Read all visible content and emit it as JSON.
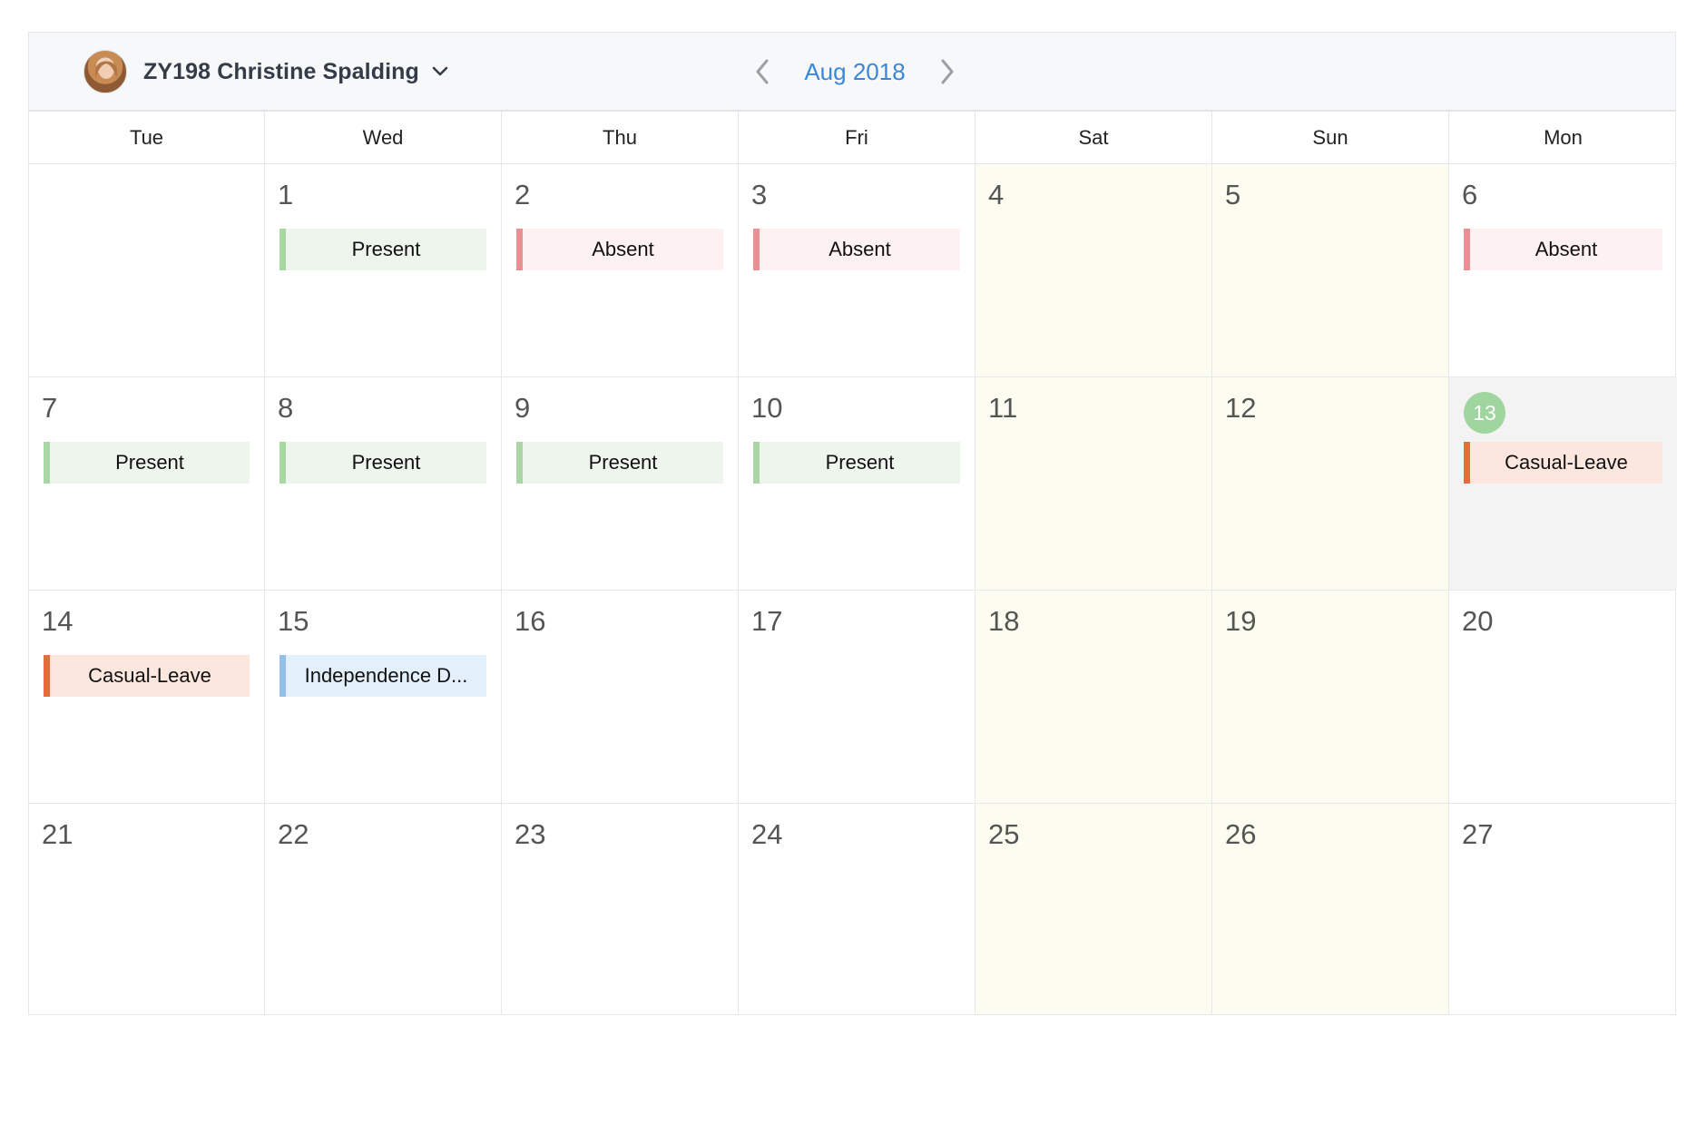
{
  "header": {
    "user_name": "ZY198 Christine Spalding",
    "month_label": "Aug 2018"
  },
  "weekdays": [
    "Tue",
    "Wed",
    "Thu",
    "Fri",
    "Sat",
    "Sun",
    "Mon"
  ],
  "weeks": [
    [
      {
        "num": "",
        "weekend": false
      },
      {
        "num": "1",
        "event": {
          "label": "Present",
          "kind": "present"
        }
      },
      {
        "num": "2",
        "event": {
          "label": "Absent",
          "kind": "absent"
        }
      },
      {
        "num": "3",
        "event": {
          "label": "Absent",
          "kind": "absent"
        }
      },
      {
        "num": "4",
        "weekend": true
      },
      {
        "num": "5",
        "weekend": true
      },
      {
        "num": "6",
        "event": {
          "label": "Absent",
          "kind": "absent"
        }
      }
    ],
    [
      {
        "num": "7",
        "event": {
          "label": "Present",
          "kind": "present"
        }
      },
      {
        "num": "8",
        "event": {
          "label": "Present",
          "kind": "present"
        }
      },
      {
        "num": "9",
        "event": {
          "label": "Present",
          "kind": "present"
        }
      },
      {
        "num": "10",
        "event": {
          "label": "Present",
          "kind": "present"
        }
      },
      {
        "num": "11",
        "weekend": true
      },
      {
        "num": "12",
        "weekend": true
      },
      {
        "num": "13",
        "today": true,
        "event": {
          "label": "Casual-Leave",
          "kind": "leave"
        }
      }
    ],
    [
      {
        "num": "14",
        "event": {
          "label": "Casual-Leave",
          "kind": "leave"
        }
      },
      {
        "num": "15",
        "event": {
          "label": "Independence D...",
          "kind": "holiday"
        }
      },
      {
        "num": "16"
      },
      {
        "num": "17"
      },
      {
        "num": "18",
        "weekend": true
      },
      {
        "num": "19",
        "weekend": true
      },
      {
        "num": "20"
      }
    ],
    [
      {
        "num": "21"
      },
      {
        "num": "22"
      },
      {
        "num": "23"
      },
      {
        "num": "24"
      },
      {
        "num": "25",
        "weekend": true
      },
      {
        "num": "26",
        "weekend": true
      },
      {
        "num": "27"
      }
    ]
  ],
  "colors": {
    "accent": "#3b86d6",
    "present": "#a9d6a4",
    "absent": "#ea8f94",
    "leave": "#e56d3c",
    "holiday": "#95c0e6",
    "weekend_bg": "#fcfdf0",
    "today_badge": "#9fd59f"
  },
  "icons": {
    "user_dropdown": "chevron-down-icon",
    "prev": "chevron-left-icon",
    "next": "chevron-right-icon"
  }
}
